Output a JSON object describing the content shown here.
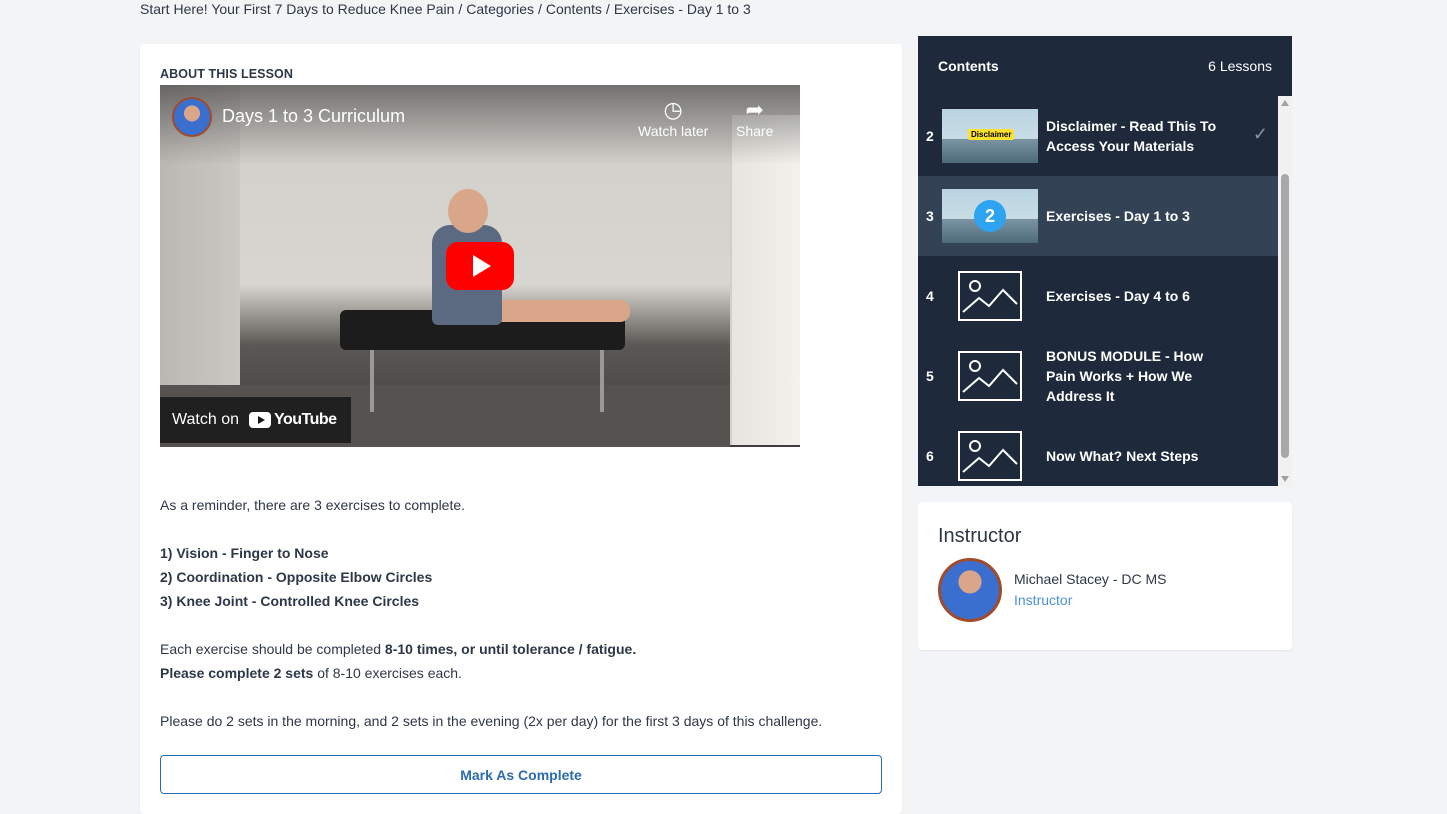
{
  "breadcrumb": {
    "items": [
      "Start Here! Your First 7 Days to Reduce Knee Pain",
      "Categories",
      "Contents",
      "Exercises - Day 1 to 3"
    ],
    "separator": "/"
  },
  "lesson": {
    "heading": "ABOUT THIS LESSON",
    "video": {
      "title": "Days 1 to 3 Curriculum",
      "watch_later": "Watch later",
      "share": "Share",
      "watch_on": "Watch on",
      "youtube": "YouTube"
    },
    "intro": "As a reminder, there are 3 exercises to complete.",
    "exercises": [
      "1) Vision - Finger to Nose",
      "2) Coordination - Opposite Elbow Circles",
      "3) Knee Joint - Controlled Knee Circles"
    ],
    "line1_prefix": "Each exercise should be completed ",
    "line1_bold": "8-10 times, or until tolerance / fatigue.",
    "line2_bold": "Please complete 2 sets",
    "line2_suffix": " of 8-10 exercises each.",
    "schedule": "Please do 2 sets in the morning, and 2 sets in the evening (2x per day) for the first 3 days of this challenge.",
    "complete_label": "Mark As Complete"
  },
  "contents": {
    "title": "Contents",
    "count": "6 Lessons",
    "items": [
      {
        "num": "2",
        "title": "Disclaimer - Read This To Access Your Materials",
        "thumb": "photo-disclaimer",
        "badge": "Disclaimer",
        "completed": true
      },
      {
        "num": "3",
        "title": "Exercises - Day 1 to 3",
        "thumb": "photo-number",
        "badge": "2",
        "active": true
      },
      {
        "num": "4",
        "title": "Exercises - Day 4 to 6",
        "thumb": "image-placeholder-icon"
      },
      {
        "num": "5",
        "title": "BONUS MODULE - How Pain Works + How We Address It",
        "thumb": "image-placeholder-icon"
      },
      {
        "num": "6",
        "title": "Now What? Next Steps",
        "thumb": "image-placeholder-icon"
      }
    ]
  },
  "instructor": {
    "heading": "Instructor",
    "name": "Michael Stacey - DC MS",
    "role": "Instructor"
  },
  "colors": {
    "panel_bg": "#1e2a3b",
    "active_item": "#344256",
    "accent": "#2b6cb0",
    "youtube_red": "#ff0000"
  }
}
